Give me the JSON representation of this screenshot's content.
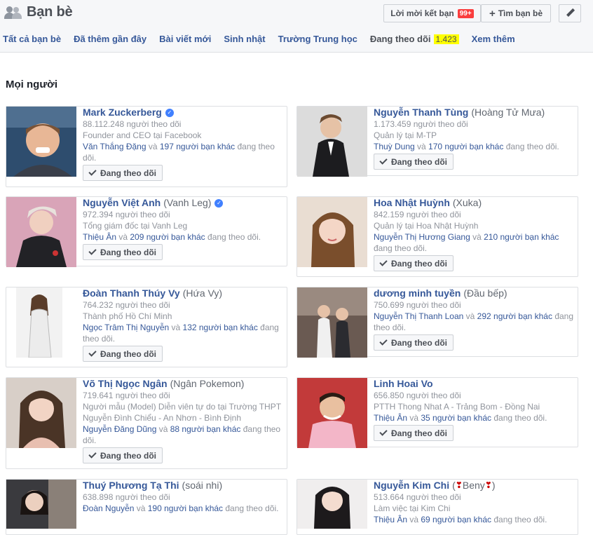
{
  "header": {
    "title": "Bạn bè",
    "friend_requests_label": "Lời mời kết bạn",
    "friend_requests_badge": "99+",
    "find_friends_label": "Tìm bạn bè"
  },
  "tabs": [
    {
      "label": "Tất cả bạn bè"
    },
    {
      "label": "Đã thêm gần đây"
    },
    {
      "label": "Bài viết mới"
    },
    {
      "label": "Sinh nhật"
    },
    {
      "label": "Trường Trung học"
    },
    {
      "label": "Đang theo dõi",
      "count": "1.423"
    },
    {
      "label": "Xem thêm"
    }
  ],
  "section_title": "Mọi người",
  "follow_button_label": "Đang theo dõi",
  "cards": [
    {
      "name": "Mark Zuckerberg",
      "alias": "",
      "verified": true,
      "followers": "88.112.248 người theo dõi",
      "detail": "Founder and CEO tại Facebook",
      "mutual_name": "Văn Thắng Đặng",
      "mutual_mid": " và ",
      "mutual_link": "197 người bạn khác",
      "mutual_tail": " đang theo dõi."
    },
    {
      "name": "Nguyễn Thanh Tùng",
      "alias": "(Hoàng Tử Mưa)",
      "verified": false,
      "followers": "1.173.459 người theo dõi",
      "detail": "Quản lý tại M-TP",
      "mutual_name": "Thuỳ Dung",
      "mutual_mid": " và ",
      "mutual_link": "170 người bạn khác",
      "mutual_tail": " đang theo dõi."
    },
    {
      "name": "Nguyễn Việt Anh",
      "alias": "(Vanh Leg)",
      "verified": true,
      "followers": "972.394 người theo dõi",
      "detail": "Tổng giám đốc tại Vanh Leg",
      "mutual_name": "Thiệu Ân",
      "mutual_mid": " và ",
      "mutual_link": "209 người bạn khác",
      "mutual_tail": " đang theo dõi."
    },
    {
      "name": "Hoa Nhật Huỳnh",
      "alias": "(Xuka)",
      "verified": false,
      "followers": "842.159 người theo dõi",
      "detail": "Quản lý tại Hoa Nhật Huỳnh",
      "mutual_name": "Nguyễn Thị Hương Giang",
      "mutual_mid": " và ",
      "mutual_link": "210 người bạn khác",
      "mutual_tail": " đang theo dõi."
    },
    {
      "name": "Đoàn Thanh Thúy Vy",
      "alias": "(Hứa Vy)",
      "verified": false,
      "followers": "764.232 người theo dõi",
      "detail": "Thành phố Hồ Chí Minh",
      "mutual_name": "Ngọc Trâm Thị Nguyễn",
      "mutual_mid": " và ",
      "mutual_link": "132 người bạn khác",
      "mutual_tail": " đang theo dõi."
    },
    {
      "name": "dương minh tuyền",
      "alias": "(Đầu bếp)",
      "verified": false,
      "followers": "750.699 người theo dõi",
      "detail": "",
      "mutual_name": "Nguyễn Thị Thanh Loan",
      "mutual_mid": " và ",
      "mutual_link": "292 người bạn khác",
      "mutual_tail": " đang theo dõi."
    },
    {
      "name": "Võ Thị Ngọc Ngân",
      "alias": "(Ngân Pokemon)",
      "verified": false,
      "followers": "719.641 người theo dõi",
      "detail": "Người mẫu (Model) Diễn viên tự do tại Trường THPT Nguyễn Đình Chiểu - An Nhơn - Bình Định",
      "mutual_name": "Nguyễn Đăng Dũng",
      "mutual_mid": " và ",
      "mutual_link": "88 người bạn khác",
      "mutual_tail": " đang theo dõi."
    },
    {
      "name": "Linh Hoai Vo",
      "alias": "",
      "verified": false,
      "followers": "656.850 người theo dõi",
      "detail": "PTTH Thong Nhat A - Trảng Bom - Đồng Nai",
      "mutual_name": "Thiệu Ân",
      "mutual_mid": " và ",
      "mutual_link": "35 người bạn khác",
      "mutual_tail": " đang theo dõi."
    },
    {
      "name": "Thuý Phương Tạ Thi",
      "alias": "(soái nhi)",
      "verified": false,
      "followers": "638.898 người theo dõi",
      "detail": "",
      "mutual_name": "Đoàn Nguyễn",
      "mutual_mid": " và ",
      "mutual_link": "190 người bạn khác",
      "mutual_tail": " đang theo dõi."
    },
    {
      "name": "Nguyễn Kim Chi",
      "alias": "(",
      "alias_mid": "Beny",
      "alias_end": ")",
      "verified": false,
      "followers": "513.664 người theo dõi",
      "detail": "Làm việc tại Kim Chi",
      "mutual_name": "Thiệu Ân",
      "mutual_mid": " và ",
      "mutual_link": "69 người bạn khác",
      "mutual_tail": " đang theo dõi."
    }
  ]
}
